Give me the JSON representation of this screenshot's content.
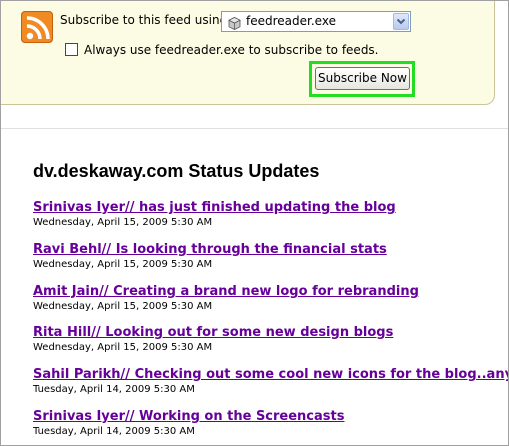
{
  "subscribe_bar": {
    "using_label": "Subscribe to this feed using",
    "reader_selected": "feedreader.exe",
    "always_use_label": "Always use feedreader.exe to subscribe to feeds.",
    "always_use_checked": false,
    "subscribe_button": "Subscribe Now",
    "rss_icon": "rss-feed-icon",
    "accent_color": "#f08a24",
    "highlight_color": "#22dd22"
  },
  "feed": {
    "title": "dv.deskaway.com Status Updates",
    "link_color": "#660099",
    "entries": [
      {
        "title": "Srinivas Iyer// has just finished updating the blog",
        "date": "Wednesday, April 15, 2009 5:30 AM"
      },
      {
        "title": "Ravi Behl// Is looking through the financial stats",
        "date": "Wednesday, April 15, 2009 5:30 AM"
      },
      {
        "title": "Amit Jain// Creating a brand new logo for rebranding",
        "date": "Wednesday, April 15, 2009 5:30 AM"
      },
      {
        "title": "Rita Hill// Looking out for some new design blogs",
        "date": "Wednesday, April 15, 2009 5:30 AM"
      },
      {
        "title": "Sahil Parikh// Checking out some cool new icons for the blog..any tips?",
        "date": "Tuesday, April 14, 2009 5:30 AM"
      },
      {
        "title": "Srinivas Iyer// Working on the Screencasts",
        "date": "Tuesday, April 14, 2009 5:30 AM"
      }
    ]
  }
}
